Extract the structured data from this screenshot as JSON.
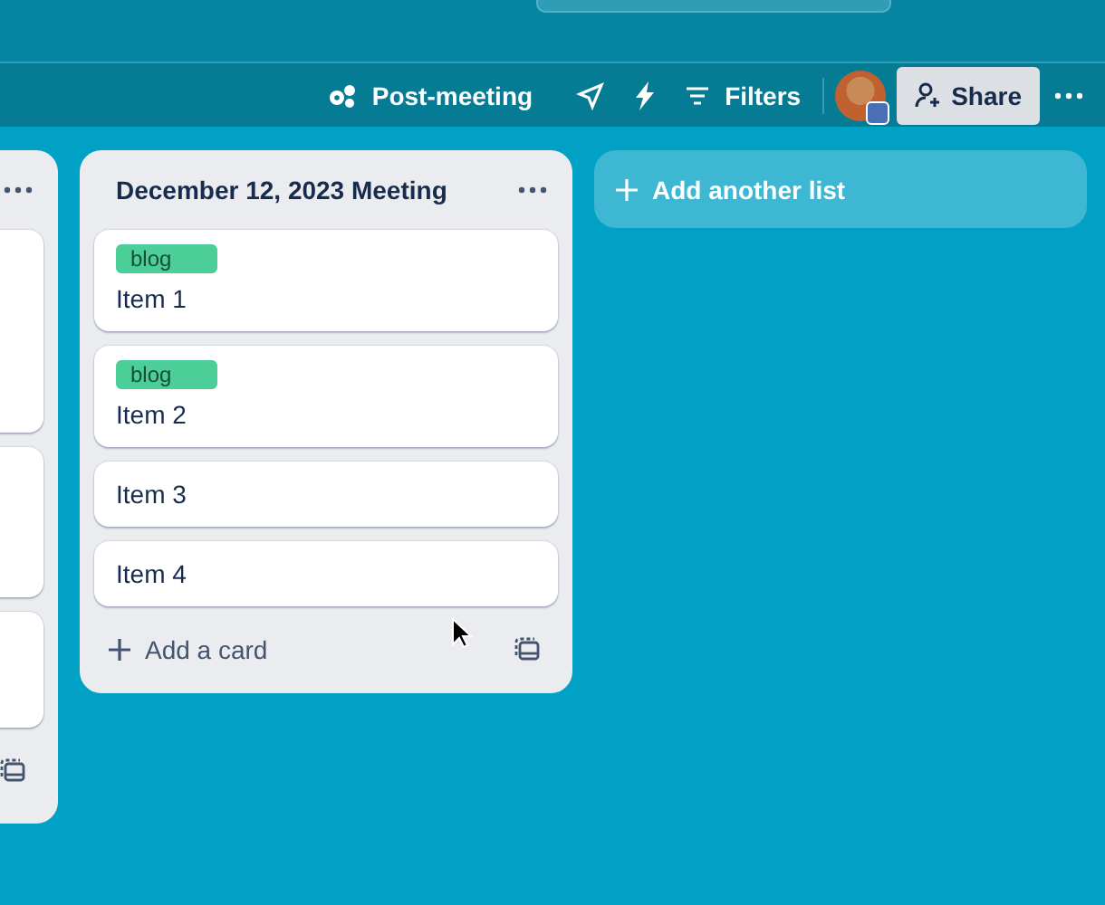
{
  "header": {
    "automation": "Post-meeting",
    "filters": "Filters",
    "share": "Share"
  },
  "lists": [
    {
      "kind": "partial",
      "cards": [
        {
          "kind": "blank"
        },
        {
          "kind": "blank"
        },
        {
          "kind": "blank"
        }
      ]
    },
    {
      "kind": "full",
      "title": "December 12, 2023 Meeting",
      "add_card": "Add a card",
      "cards": [
        {
          "kind": "text",
          "label": "blog",
          "color": "#4bce97",
          "title": "Item 1"
        },
        {
          "kind": "text",
          "label": "blog",
          "color": "#4bce97",
          "title": "Item 2"
        },
        {
          "kind": "text",
          "title": "Item 3"
        },
        {
          "kind": "text",
          "title": "Item 4"
        }
      ]
    }
  ],
  "add_list": "Add another list"
}
